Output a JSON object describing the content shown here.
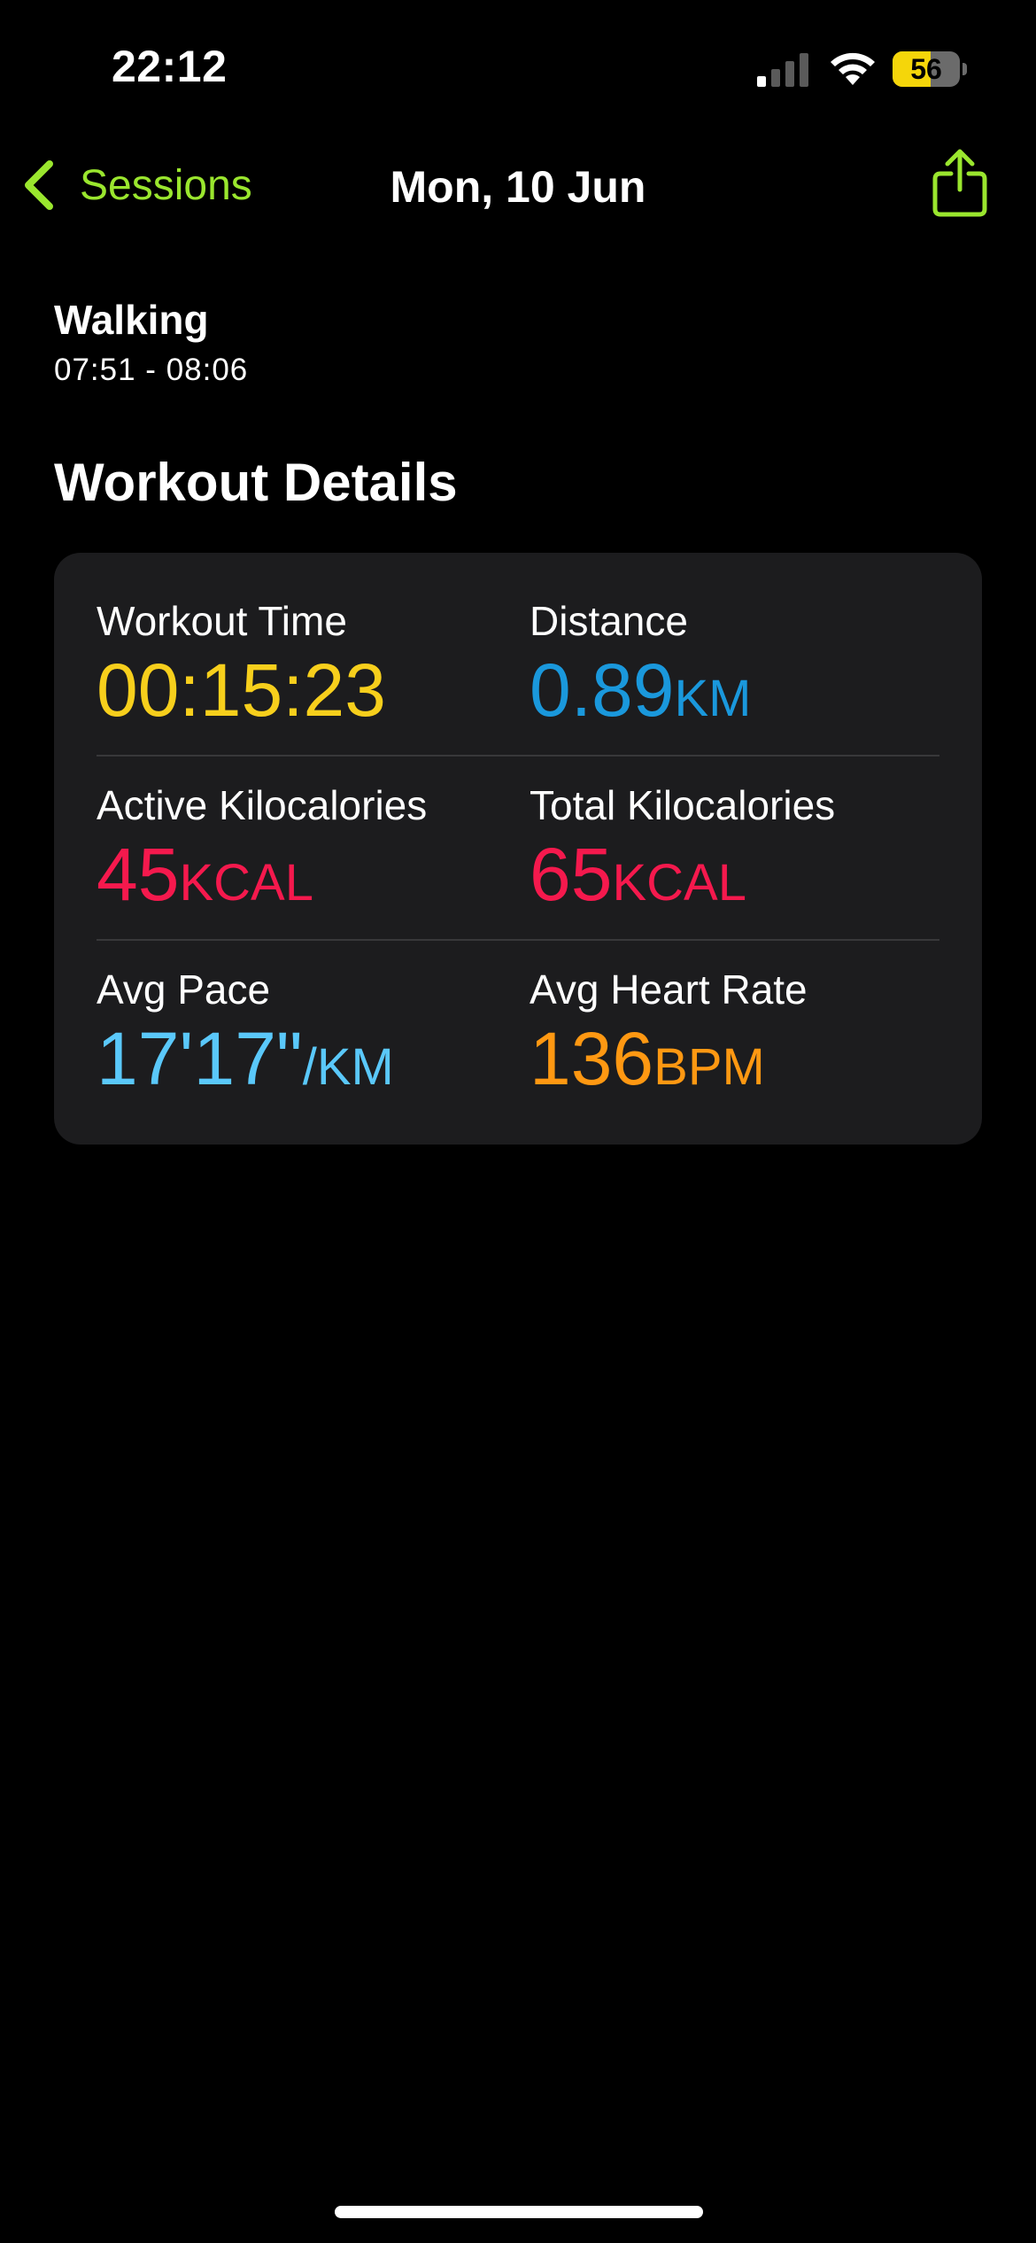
{
  "status_bar": {
    "time": "22:12",
    "battery_percent": "56",
    "battery_level": 0.56,
    "signal_bars_active": 1,
    "signal_bars_total": 4,
    "icons": [
      "signal-icon",
      "wifi-icon",
      "battery-icon"
    ]
  },
  "nav": {
    "back_label": "Sessions",
    "title": "Mon, 10 Jun",
    "back_icon": "chevron-left-icon",
    "action_icon": "share-icon",
    "accent_color": "#9ae62e"
  },
  "workout": {
    "type": "Walking",
    "time_range": "07:51 - 08:06"
  },
  "details": {
    "section_title": "Workout Details",
    "metrics": [
      {
        "label": "Workout Time",
        "value": "00:15:23",
        "unit": "",
        "color": "#f7cf1c"
      },
      {
        "label": "Distance",
        "value": "0.89",
        "unit": "KM",
        "color": "#1a98dc"
      },
      {
        "label": "Active Kilocalories",
        "value": "45",
        "unit": "KCAL",
        "color": "#f5194d"
      },
      {
        "label": "Total Kilocalories",
        "value": "65",
        "unit": "KCAL",
        "color": "#f5194d"
      },
      {
        "label": "Avg Pace",
        "value": "17'17\"",
        "unit": "/KM",
        "color": "#5ac8fa"
      },
      {
        "label": "Avg Heart Rate",
        "value": "136",
        "unit": "BPM",
        "color": "#ff9812"
      }
    ]
  }
}
